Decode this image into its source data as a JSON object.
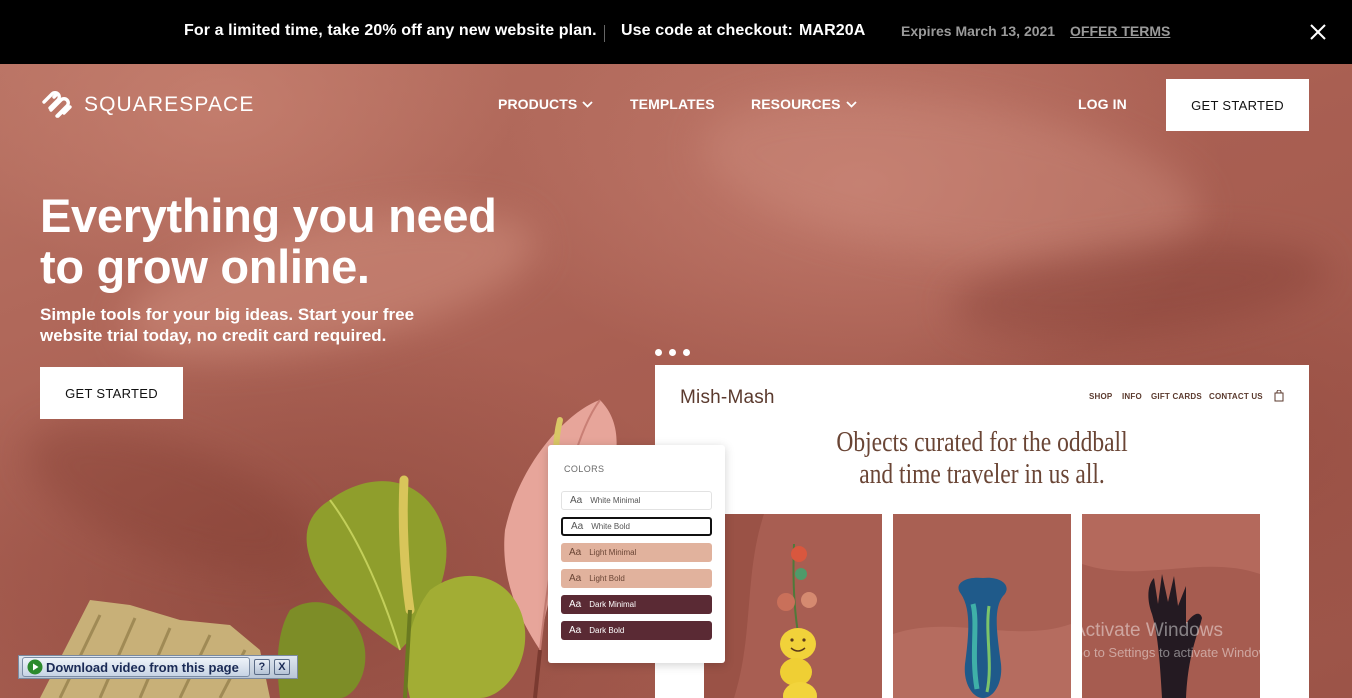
{
  "promo": {
    "offer": "For a limited time, take 20% off any new website plan.",
    "code_label": "Use code at checkout:",
    "code": "MAR20A",
    "expires": "Expires March 13, 2021",
    "terms": "OFFER TERMS",
    "close_icon": "close-icon"
  },
  "header": {
    "logo_text": "SQUARESPACE",
    "nav": {
      "products": "PRODUCTS",
      "templates": "TEMPLATES",
      "resources": "RESOURCES"
    },
    "login": "LOG IN",
    "get_started": "GET STARTED"
  },
  "hero": {
    "title_line1": "Everything you need",
    "title_line2": "to grow online.",
    "sub_line1": "Simple tools for your big ideas. Start your free",
    "sub_line2": "website trial today, no credit card required.",
    "cta": "GET STARTED"
  },
  "preview_site": {
    "logo": "Mish-Mash",
    "nav": [
      "SHOP",
      "INFO",
      "GIFT CARDS",
      "CONTACT US"
    ],
    "headline_line1": "Objects curated for the oddball",
    "headline_line2": "and time traveler in us all.",
    "cart_icon": "shopping-bag-icon"
  },
  "colors_panel": {
    "title": "COLORS",
    "options": [
      {
        "aa": "Aa",
        "label": "White Minimal",
        "bg": "#ffffff",
        "fg": "#555555",
        "selected": false
      },
      {
        "aa": "Aa",
        "label": "White Bold",
        "bg": "#ffffff",
        "fg": "#555555",
        "selected": true
      },
      {
        "aa": "Aa",
        "label": "Light Minimal",
        "bg": "#e1b29d",
        "fg": "#6a4535",
        "selected": false
      },
      {
        "aa": "Aa",
        "label": "Light Bold",
        "bg": "#e1b29d",
        "fg": "#6a4535",
        "selected": false
      },
      {
        "aa": "Aa",
        "label": "Dark Minimal",
        "bg": "#5a2a34",
        "fg": "#ffffff",
        "selected": false
      },
      {
        "aa": "Aa",
        "label": "Dark Bold",
        "bg": "#5a2a34",
        "fg": "#ffffff",
        "selected": false
      }
    ]
  },
  "download_bar": {
    "label": "Download video from this page",
    "help": "?",
    "close": "X"
  },
  "watermark": {
    "line1": "Activate Windows",
    "line2": "Go to Settings to activate Windows."
  },
  "colors": {
    "promo_bg": "#000000",
    "hero_bg": "#b06a5c",
    "button_bg": "#ffffff",
    "preview_text": "#6a4535"
  }
}
